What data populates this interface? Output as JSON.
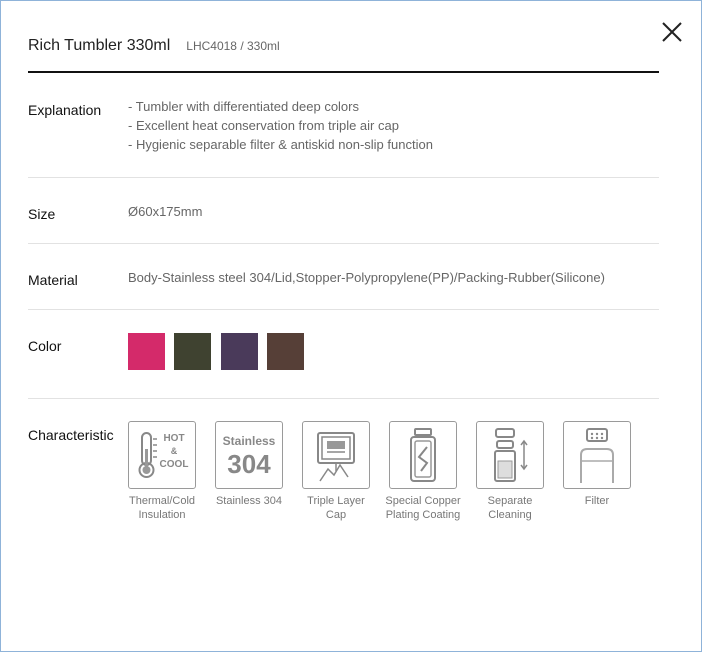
{
  "product": {
    "name": "Rich Tumbler 330ml",
    "code": "LHC4018 / 330ml"
  },
  "rows": {
    "explanation": {
      "label": "Explanation",
      "lines": [
        "- Tumbler with differentiated deep colors",
        "- Excellent heat conservation from triple air cap",
        "- Hygienic separable filter & antiskid non-slip function"
      ]
    },
    "size": {
      "label": "Size",
      "value": "Ø60x175mm"
    },
    "material": {
      "label": "Material",
      "value": "Body-Stainless steel 304/Lid,Stopper-Polypropylene(PP)/Packing-Rubber(Silicone)"
    },
    "color": {
      "label": "Color"
    },
    "characteristic": {
      "label": "Characteristic"
    }
  },
  "colors": [
    "#d42a6a",
    "#3f4230",
    "#4a3a5a",
    "#563f37"
  ],
  "features": [
    {
      "icon": "thermometer-icon",
      "icon_text": [
        "HOT",
        "&",
        "COOL"
      ],
      "caption_lines": [
        "Thermal/Cold",
        "Insulation"
      ]
    },
    {
      "icon": "stainless-304-icon",
      "icon_text": [
        "Stainless",
        "304"
      ],
      "caption_lines": [
        "Stainless 304"
      ]
    },
    {
      "icon": "triple-layer-cap-icon",
      "caption_lines": [
        "Triple Layer",
        "Cap"
      ]
    },
    {
      "icon": "copper-plating-icon",
      "caption_lines": [
        "Special Copper",
        "Plating Coating"
      ]
    },
    {
      "icon": "separate-cleaning-icon",
      "caption_lines": [
        "Separate",
        "Cleaning"
      ]
    },
    {
      "icon": "filter-icon",
      "caption_lines": [
        "Filter"
      ]
    }
  ]
}
